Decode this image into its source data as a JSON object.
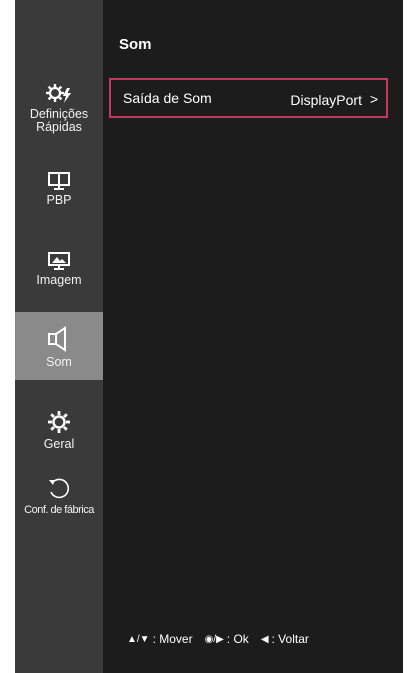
{
  "sidebar": {
    "items": [
      {
        "label": "Definições Rápidas",
        "icon": "quick-settings-icon"
      },
      {
        "label": "PBP",
        "icon": "pbp-icon"
      },
      {
        "label": "Imagem",
        "icon": "image-icon"
      },
      {
        "label": "Som",
        "icon": "speaker-icon",
        "active": true
      },
      {
        "label": "Geral",
        "icon": "gear-icon"
      },
      {
        "label": "Conf. de fábrica",
        "icon": "reset-icon"
      }
    ]
  },
  "main": {
    "title": "Som",
    "rows": [
      {
        "label": "Saída de Som",
        "value": "DisplayPort",
        "chevron": ">"
      }
    ]
  },
  "footer": {
    "move_glyph": "▲/▼",
    "move_label": ": Mover",
    "ok_glyph": "◉/▶",
    "ok_label": ": Ok",
    "back_glyph": "◀",
    "back_label": ": Voltar"
  },
  "colors": {
    "sidebar_bg": "#3a3a3a",
    "active_bg": "#8a8a8a",
    "content_bg": "#1c1c1c",
    "highlight_border": "#c7375b"
  }
}
